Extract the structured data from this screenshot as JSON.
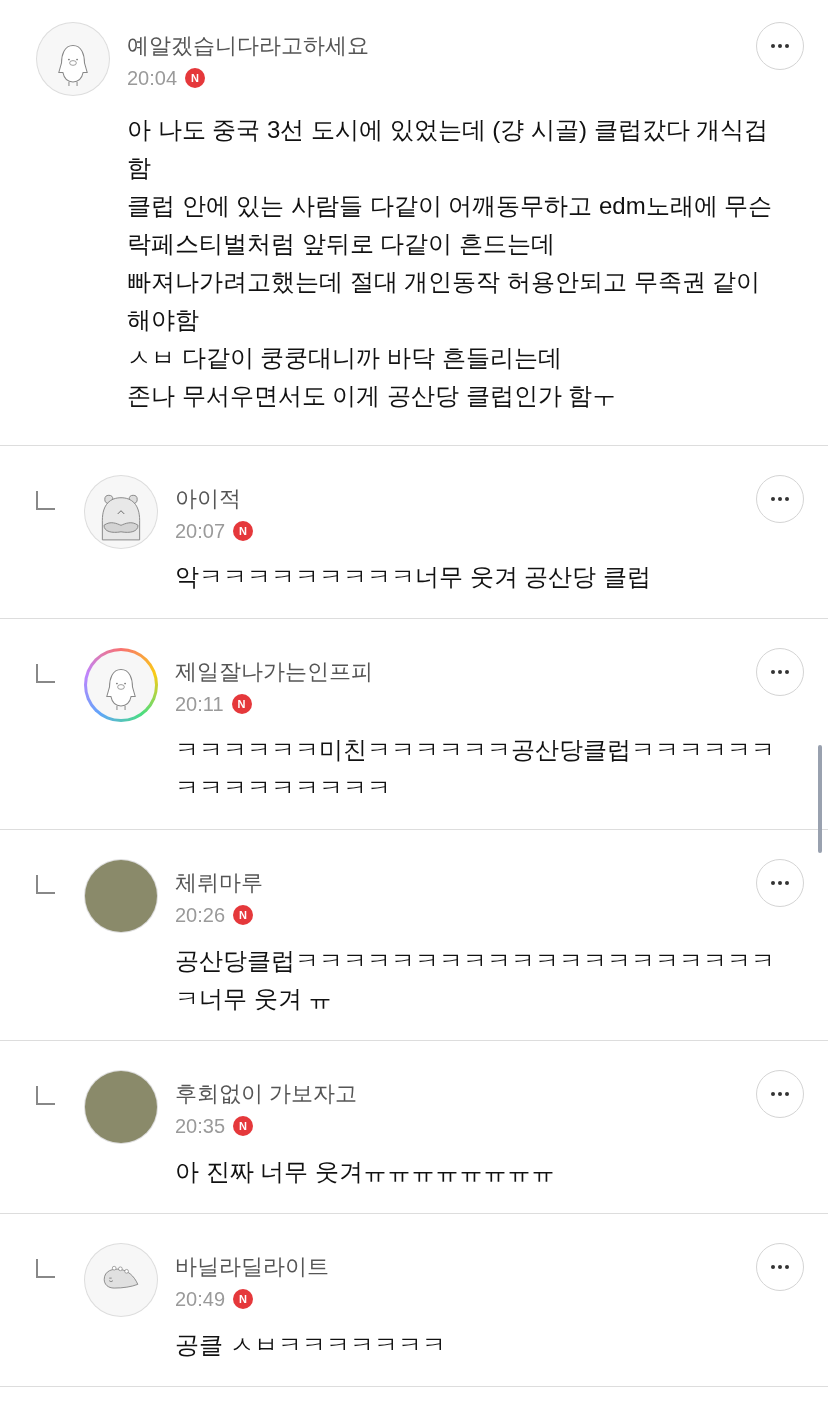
{
  "comments": [
    {
      "kind": "top",
      "author": "예알겠습니다라고하세요",
      "time": "20:04",
      "badge": "N",
      "avatar": {
        "kind": "penguin",
        "ring": false
      },
      "body": "아 나도 중국 3선 도시에 있었는데 (걍 시골) 클럽갔다 개식겁함\n클럽 안에 있는 사람들 다같이 어깨동무하고 edm노래에 무슨 락페스티벌처럼 앞뒤로 다같이 흔드는데\n빠져나가려고했는데 절대 개인동작 허용안되고 무족권 같이 해야함\nㅅㅂ 다같이 쿵쿵대니까 바닥 흔들리는데\n존나 무서우면서도 이게 공산당 클럽인가 함ㅜ"
    },
    {
      "kind": "reply",
      "author": "아이적",
      "time": "20:07",
      "badge": "N",
      "avatar": {
        "kind": "hamster",
        "ring": false
      },
      "body": "악ㅋㅋㅋㅋㅋㅋㅋㅋㅋ너무 웃겨 공산당 클럽"
    },
    {
      "kind": "reply",
      "author": "제일잘나가는인프피",
      "time": "20:11",
      "badge": "N",
      "avatar": {
        "kind": "penguin",
        "ring": true
      },
      "body": "ㅋㅋㅋㅋㅋㅋ미친ㅋㅋㅋㅋㅋㅋ공산당클럽ㅋㅋㅋㅋㅋㅋㅋㅋㅋㅋㅋㅋㅋㅋㅋ"
    },
    {
      "kind": "reply",
      "author": "체뤼마루",
      "time": "20:26",
      "badge": "N",
      "avatar": {
        "kind": "photo",
        "ring": false
      },
      "body": "공산당클럽ㅋㅋㅋㅋㅋㅋㅋㅋㅋㅋㅋㅋㅋㅋㅋㅋㅋㅋㅋㅋㅋ너무 웃겨 ㅠ"
    },
    {
      "kind": "reply",
      "author": "후회없이 가보자고",
      "time": "20:35",
      "badge": "N",
      "avatar": {
        "kind": "photo",
        "ring": false
      },
      "body": "아 진짜 너무 웃겨ㅠㅠㅠㅠㅠㅠㅠㅠ"
    },
    {
      "kind": "reply",
      "author": "바닐라딜라이트",
      "time": "20:49",
      "badge": "N",
      "avatar": {
        "kind": "dino",
        "ring": false
      },
      "body": "공클 ㅅㅂㅋㅋㅋㅋㅋㅋㅋ"
    }
  ]
}
